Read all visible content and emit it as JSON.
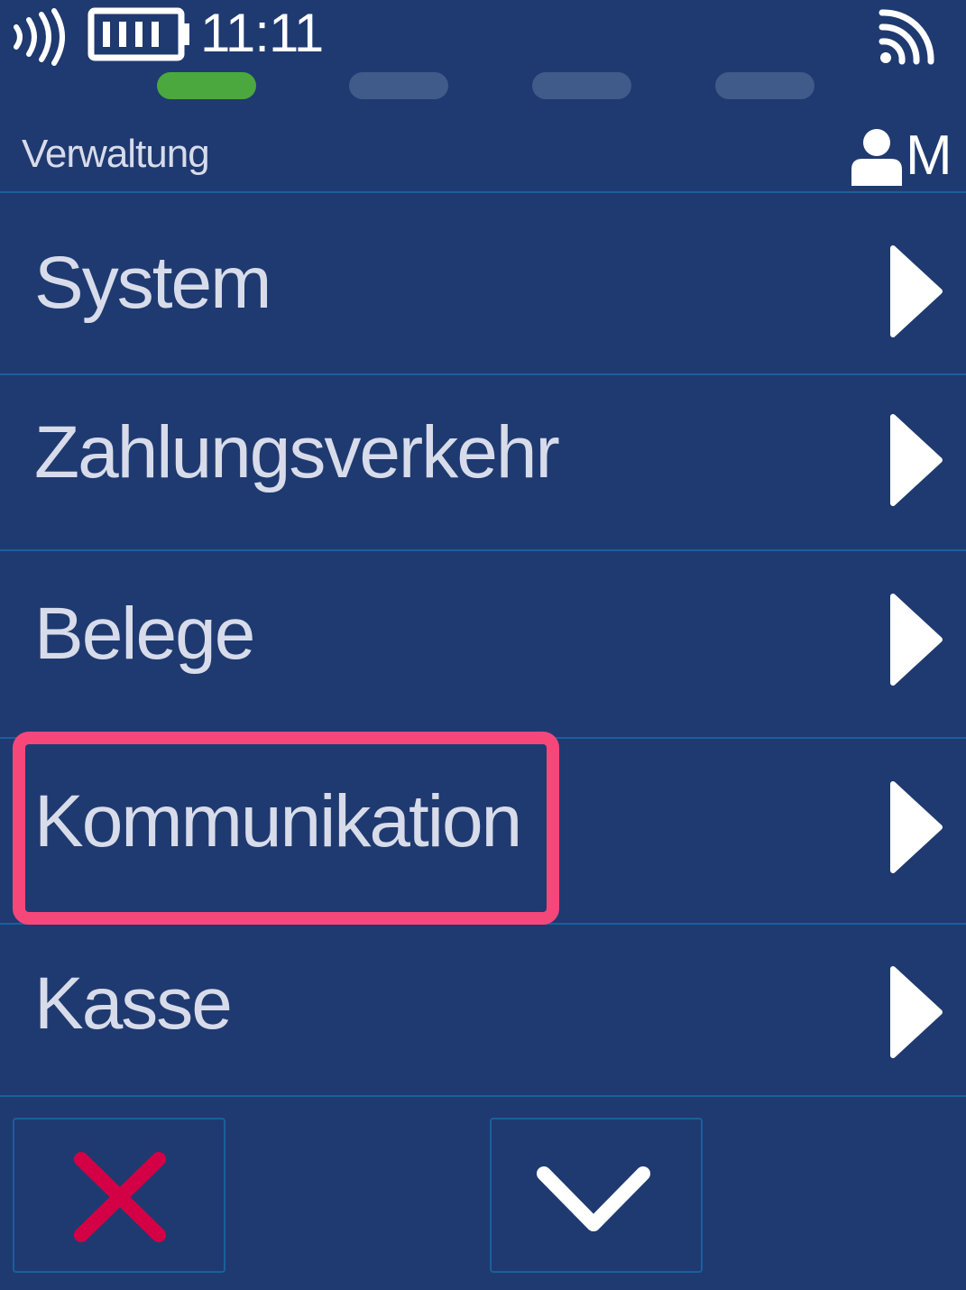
{
  "status_bar": {
    "time": "11:11",
    "icons": [
      "nfc-icon",
      "battery-icon",
      "signal-icon"
    ]
  },
  "progress": {
    "total_steps": 4,
    "current_step": 1,
    "active_color": "#4aa83f",
    "inactive_color": "#405a8a"
  },
  "header": {
    "title": "Verwaltung",
    "user_level": "M",
    "icon": "user-icon"
  },
  "menu": {
    "items": [
      {
        "label": "System"
      },
      {
        "label": "Zahlungsverkehr"
      },
      {
        "label": "Belege"
      },
      {
        "label": "Kommunikation",
        "highlighted": true
      },
      {
        "label": "Kasse"
      }
    ]
  },
  "buttons": {
    "cancel_icon": "close-icon",
    "down_icon": "chevron-down-icon"
  },
  "colors": {
    "background": "#1f3a70",
    "divider": "#1b5f9e",
    "highlight": "#f5477a",
    "cancel": "#d40045",
    "text": "#d8dcea"
  }
}
